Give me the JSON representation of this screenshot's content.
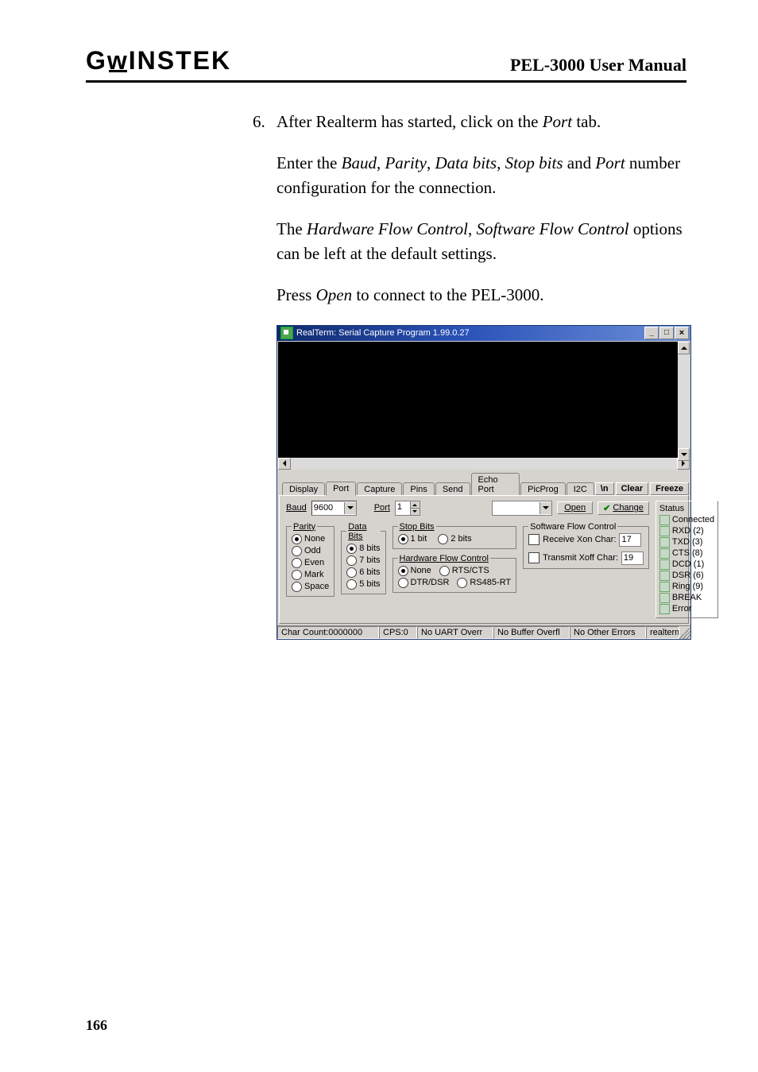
{
  "header": {
    "brand": "GWINSTEK",
    "doc_title": "PEL-3000 User Manual"
  },
  "step_number": "6.",
  "step_text_parts": {
    "a1": "After Realterm has started, click on the ",
    "a2": "Port",
    "a3": " tab."
  },
  "para1": {
    "p1": "Enter the ",
    "baud": "Baud",
    "c1": ", ",
    "parity": "Parity",
    "c2": ", ",
    "databits": "Data bits",
    "c3": ", ",
    "stopbits": "Stop bits",
    "c4": " and ",
    "port": "Port",
    "p2": " number configuration for the connection."
  },
  "para2": {
    "p1": "The ",
    "hfc": "Hardware Flow Control",
    "c1": ", ",
    "sfc": "Software Flow Control",
    "p2": " options can be left at the default settings."
  },
  "para3": {
    "p1": "Press ",
    "open": "Open",
    "p2": " to connect to the PEL-3000."
  },
  "page_number": "166",
  "win": {
    "title": "RealTerm: Serial Capture Program 1.99.0.27",
    "min": "_",
    "max": "□",
    "close": "×",
    "tabs": {
      "display": "Display",
      "port": "Port",
      "capture": "Capture",
      "pins": "Pins",
      "send": "Send",
      "echoport": "Echo Port",
      "picprog": "PicProg",
      "i2c": "I2C"
    },
    "rightbtns": {
      "bn": "\\n",
      "clear": "Clear",
      "freeze": "Freeze"
    },
    "baud_label": "Baud",
    "baud_value": "9600",
    "port_label": "Port",
    "port_value": "1",
    "open_btn": "Open",
    "change_btn": "Change",
    "parity": {
      "legend": "Parity",
      "none": "None",
      "odd": "Odd",
      "even": "Even",
      "mark": "Mark",
      "space": "Space"
    },
    "databits": {
      "legend": "Data Bits",
      "b8": "8 bits",
      "b7": "7 bits",
      "b6": "6 bits",
      "b5": "5 bits"
    },
    "stopbits": {
      "legend": "Stop Bits",
      "s1": "1 bit",
      "s2": "2 bits"
    },
    "hfc": {
      "legend": "Hardware Flow Control",
      "none": "None",
      "rtscts": "RTS/CTS",
      "dtrdsr": "DTR/DSR",
      "rs485": "RS485-RT"
    },
    "sfc": {
      "legend": "Software Flow Control",
      "rx": "Receive  Xon Char:",
      "rx_val": "17",
      "tx": "Transmit  Xoff Char:",
      "tx_val": "19"
    },
    "status": {
      "hdr": "Status",
      "connected": "Connected",
      "rxd": "RXD (2)",
      "txd": "TXD (3)",
      "cts": "CTS (8)",
      "dcd": "DCD (1)",
      "dsr": "DSR (6)",
      "ring": "Ring (9)",
      "break": "BREAK",
      "error": "Error"
    },
    "statusbar": {
      "c1": "Char Count:0000000",
      "c2": "CPS:0",
      "c3": "No UART Overr",
      "c4": "No Buffer Overfl",
      "c5": "No Other Errors",
      "c6": "realterm.sourceforge.net"
    }
  }
}
